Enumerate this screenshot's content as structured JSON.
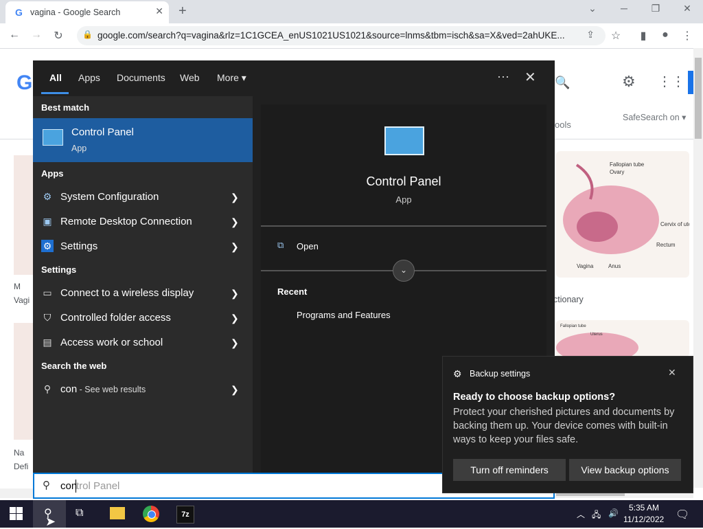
{
  "browser": {
    "tab_title": "vagina - Google Search",
    "url": "google.com/search?q=vagina&rlz=1C1GCEA_enUS1021US1021&source=lnms&tbm=isch&sa=X&ved=2ahUKE..."
  },
  "google": {
    "logo_letter": "G",
    "safesearch": "SafeSearch on",
    "tools_fragment": "ools",
    "dictionary_fragment": "ctionary",
    "left_label_1": "M",
    "left_label_2": "Vagi",
    "left_label_3": "Na",
    "left_label_4": "Defi",
    "diagram_labels": {
      "fallopian": "Fallopian tube",
      "ovary": "Ovary",
      "cervix": "Cervix of uterus",
      "rectum": "Rectum",
      "vagina": "Vagina",
      "anus": "Anus",
      "fallopian2": "Fallopian tube",
      "uterus": "Uterus"
    }
  },
  "search_panel": {
    "tabs": [
      "All",
      "Apps",
      "Documents",
      "Web",
      "More"
    ],
    "best_match_header": "Best match",
    "best_match": {
      "title": "Control Panel",
      "subtitle": "App"
    },
    "apps_header": "Apps",
    "apps": [
      {
        "label": "System Configuration"
      },
      {
        "label": "Remote Desktop Connection"
      },
      {
        "label": "Settings"
      }
    ],
    "settings_header": "Settings",
    "settings": [
      {
        "label": "Connect to a wireless display"
      },
      {
        "label": "Controlled folder access"
      },
      {
        "label": "Access work or school"
      }
    ],
    "web_header": "Search the web",
    "web_query": "con",
    "web_suffix": " - See web results",
    "detail": {
      "title": "Control Panel",
      "subtitle": "App",
      "open_label": "Open",
      "recent_header": "Recent",
      "recent_items": [
        "Programs and Features"
      ]
    },
    "search_box": {
      "typed": "con",
      "autocomplete": "trol Panel"
    }
  },
  "toast": {
    "app": "Backup settings",
    "title": "Ready to choose backup options?",
    "body": "Protect your cherished pictures and documents by backing them up. Your device comes with built-in ways to keep your files safe.",
    "button_off": "Turn off reminders",
    "button_view": "View backup options"
  },
  "taskbar": {
    "time": "5:35 AM",
    "date": "11/12/2022",
    "sevenzip_label": "7z"
  },
  "colors": {
    "accent": "#0078d7",
    "best_match_bg": "#1e5da0",
    "panel_bg": "#202020"
  }
}
